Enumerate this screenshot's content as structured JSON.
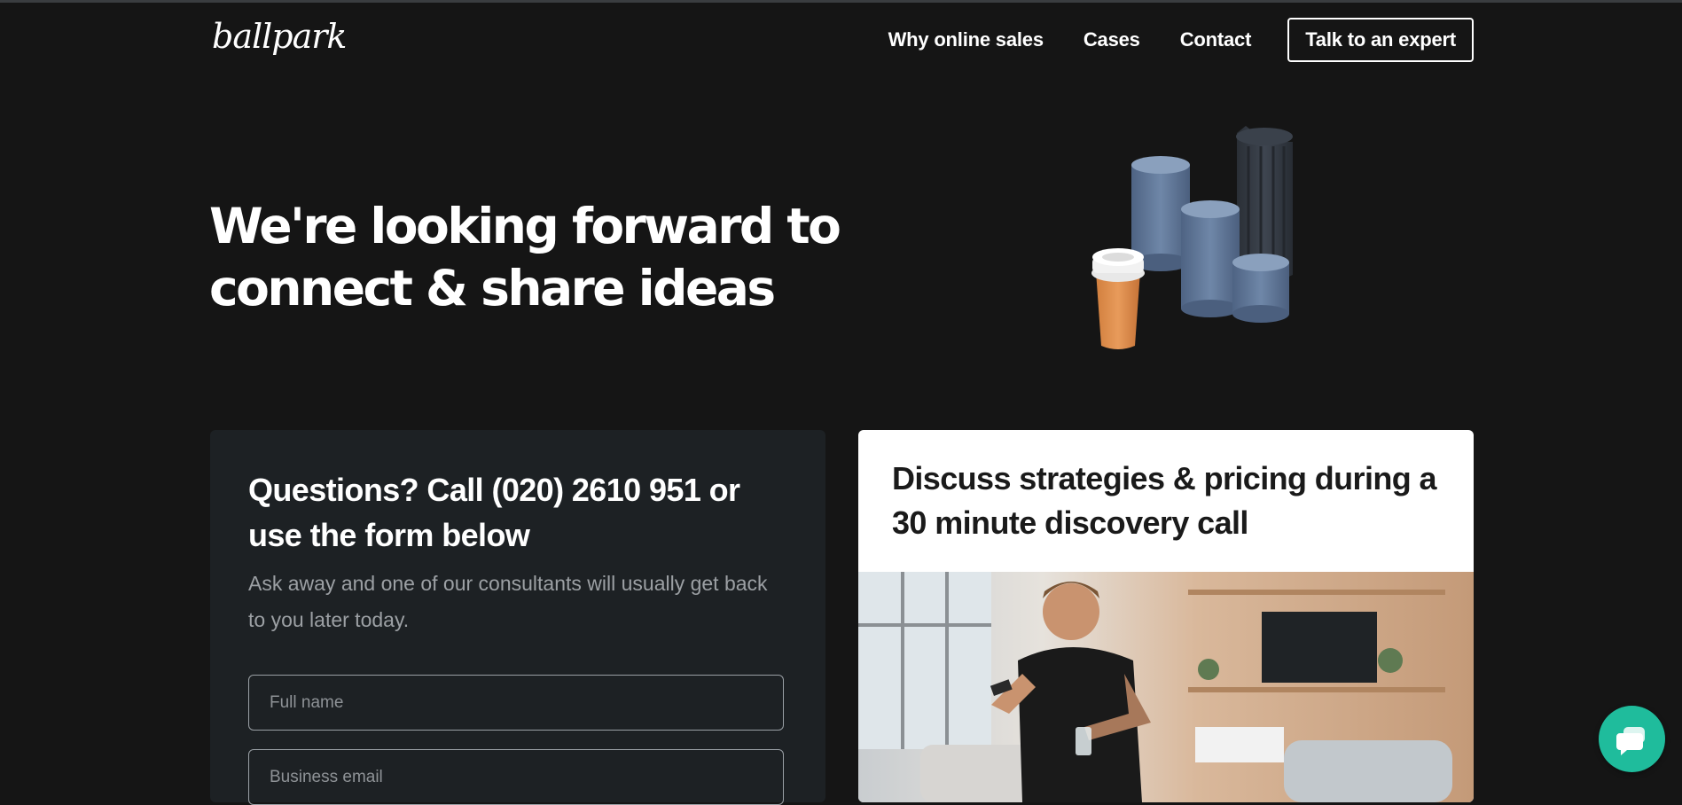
{
  "header": {
    "logo_text": "ballpark",
    "nav": [
      {
        "label": "Why online sales"
      },
      {
        "label": "Cases"
      },
      {
        "label": "Contact"
      }
    ],
    "cta_label": "Talk to an expert"
  },
  "hero": {
    "title_line1": "We're looking forward to",
    "title_line2": "connect & share ideas"
  },
  "contact_card": {
    "title": "Questions? Call (020) 2610 951 or use the form below",
    "subtitle": "Ask away and one of our consultants will usually get back to you later today.",
    "fields": [
      {
        "placeholder": "Full name"
      },
      {
        "placeholder": "Business email"
      }
    ]
  },
  "discovery_card": {
    "title": "Discuss strategies & pricing during a 30 minute discovery call"
  },
  "chat": {
    "icon": "chat-icon",
    "color": "#1fbc9c"
  },
  "colors": {
    "background": "#151515",
    "card": "#1d2124",
    "accent": "#1fbc9c"
  }
}
